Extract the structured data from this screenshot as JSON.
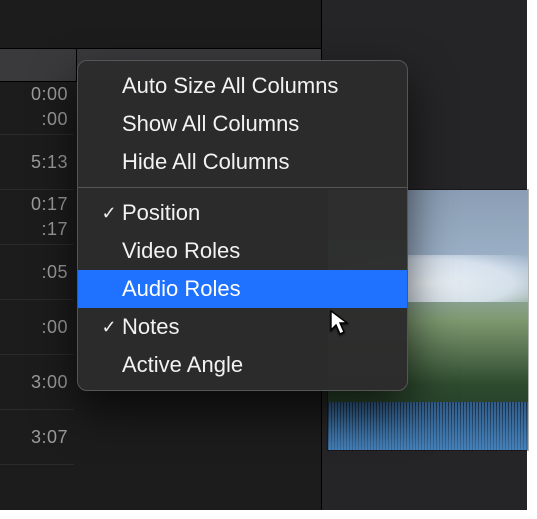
{
  "tabbar": {
    "hint": ""
  },
  "timeline": {
    "rows": [
      {
        "a": "0:00",
        "b": ":00"
      },
      {
        "a": "5:13",
        "b": ""
      },
      {
        "a": "0:17",
        "b": ":17"
      },
      {
        "a": ":05",
        "b": ""
      },
      {
        "a": ":00",
        "b": ""
      },
      {
        "a": "3:00",
        "b": ""
      },
      {
        "a": "3:07",
        "b": ""
      }
    ]
  },
  "menu": {
    "items": [
      {
        "label": "Auto Size All Columns",
        "checked": false
      },
      {
        "label": "Show All Columns",
        "checked": false
      },
      {
        "label": "Hide All Columns",
        "checked": false
      }
    ],
    "columns": [
      {
        "label": "Position",
        "checked": true
      },
      {
        "label": "Video Roles",
        "checked": false
      },
      {
        "label": "Audio Roles",
        "checked": false,
        "highlight": true
      },
      {
        "label": "Notes",
        "checked": true
      },
      {
        "label": "Active Angle",
        "checked": false
      }
    ]
  },
  "glyphs": {
    "check": "✓"
  }
}
